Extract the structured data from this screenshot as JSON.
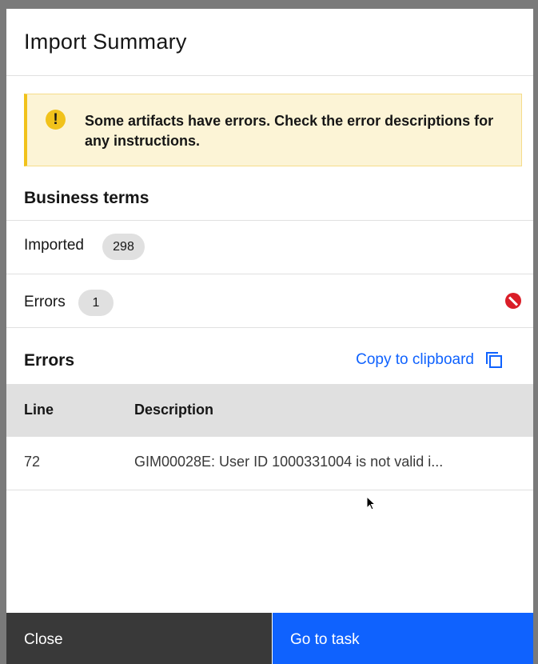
{
  "modal": {
    "title": "Import Summary"
  },
  "notification": {
    "kind": "warning",
    "icon": "warning-icon",
    "message": "Some artifacts have errors. Check the error descriptions for any instructions."
  },
  "business_terms": {
    "title": "Business terms",
    "imported_label": "Imported",
    "imported_count": "298",
    "errors_label": "Errors",
    "errors_count": "1",
    "errors_status_icon": "error-icon"
  },
  "errors_section": {
    "title": "Errors",
    "copy_label": "Copy to clipboard",
    "copy_icon": "copy-icon",
    "columns": [
      "Line",
      "Description"
    ],
    "rows": [
      {
        "line": "72",
        "description": "GIM00028E: User ID 1000331004 is not valid i..."
      }
    ]
  },
  "footer": {
    "close_label": "Close",
    "go_to_task_label": "Go to task"
  },
  "colors": {
    "primary": "#0f62fe",
    "warning": "#f1c21b",
    "error": "#da1e28",
    "secondary_button": "#393939"
  }
}
